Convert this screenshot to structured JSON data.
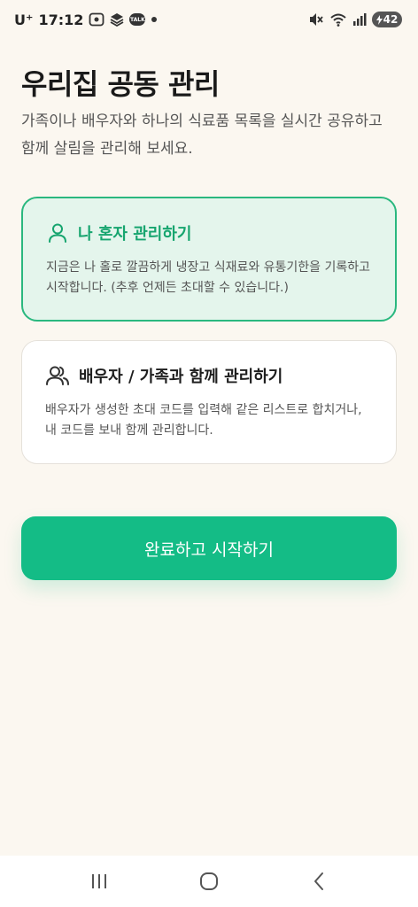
{
  "status_bar": {
    "carrier": "U⁺",
    "time": "17:12",
    "talk_badge": "TALK",
    "battery": "42",
    "icons": [
      "screenshot-icon",
      "stack-icon",
      "talk-icon",
      "dot-icon",
      "mute-icon",
      "wifi-icon",
      "signal-icon",
      "battery-icon"
    ]
  },
  "header": {
    "title": "우리집 공동 관리",
    "description": "가족이나 배우자와 하나의 식료품 목록을 실시간 공유하고 함께 살림을 관리해 보세요."
  },
  "options": {
    "solo": {
      "icon": "person-icon",
      "title": "나 혼자 관리하기",
      "description": "지금은 나 홀로 깔끔하게 냉장고 식재료와 유통기한을 기록하고 시작합니다. (추후 언제든 초대할 수 있습니다.)",
      "selected": true
    },
    "family": {
      "icon": "people-icon",
      "title": "배우자 / 가족과 함께 관리하기",
      "description": "배우자가 생성한 초대 코드를 입력해 같은 리스트로 합치거나, 내 코드를 보내 함께 관리합니다.",
      "selected": false
    }
  },
  "primary_button": {
    "label": "완료하고 시작하기"
  },
  "nav_bar": {
    "icons": [
      "recents-icon",
      "home-icon",
      "back-icon"
    ]
  },
  "colors": {
    "background": "#fbf7f0",
    "accent": "#14bc86",
    "selected_card_bg": "#e4f5ec",
    "selected_border": "#2ab87f"
  }
}
